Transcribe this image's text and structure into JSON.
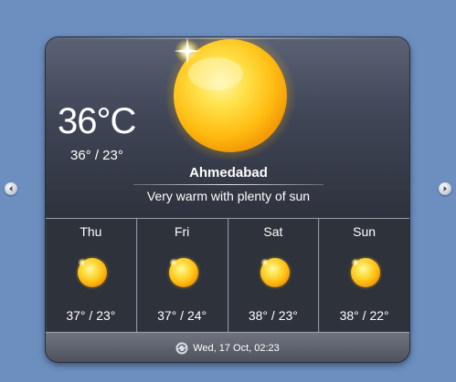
{
  "current": {
    "temperature": "36°C",
    "hi_lo": "36° / 23°",
    "city": "Ahmedabad",
    "description": "Very warm with plenty of sun",
    "icon": "sun-icon"
  },
  "forecast": [
    {
      "day": "Thu",
      "hi_lo": "37° / 23°",
      "icon": "sun-icon"
    },
    {
      "day": "Fri",
      "hi_lo": "37° / 24°",
      "icon": "sun-icon"
    },
    {
      "day": "Sat",
      "hi_lo": "38° / 23°",
      "icon": "sun-icon"
    },
    {
      "day": "Sun",
      "hi_lo": "38° / 22°",
      "icon": "sun-icon"
    }
  ],
  "footer": {
    "updated": "Wed, 17 Oct, 02:23",
    "refresh_icon": "refresh-icon"
  },
  "navigation": {
    "prev_icon": "chevron-left-icon",
    "next_icon": "chevron-right-icon"
  },
  "colors": {
    "background": "#6c8fc0",
    "panel_top": "#5b6275",
    "panel_bottom": "#2e323d",
    "sun": "#ffc21a"
  }
}
